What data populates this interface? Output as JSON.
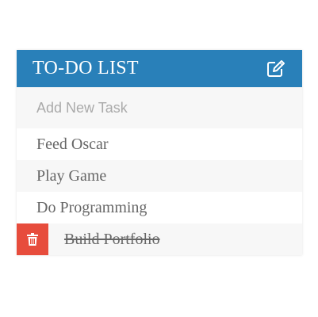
{
  "header": {
    "title": "TO-DO LIST",
    "edit_icon": "edit-icon"
  },
  "new_task": {
    "placeholder": "Add New Task",
    "value": ""
  },
  "tasks": [
    {
      "label": "Feed Oscar",
      "completed": false
    },
    {
      "label": "Play Game",
      "completed": false
    },
    {
      "label": "Do Programming",
      "completed": false
    },
    {
      "label": "Build Portfolio",
      "completed": true
    }
  ],
  "delete_icon": "trash-icon",
  "colors": {
    "header_bg": "#2980b9",
    "delete_bg": "#e74c3c",
    "text": "#666666"
  }
}
